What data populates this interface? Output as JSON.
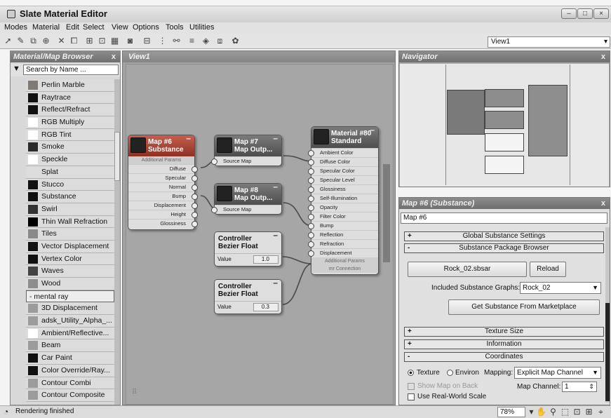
{
  "window": {
    "title": "Slate Material Editor",
    "min": "–",
    "max": "□",
    "close": "×"
  },
  "menu": [
    "Modes",
    "Material",
    "Edit",
    "Select",
    "View",
    "Options",
    "Tools",
    "Utilities"
  ],
  "toolbar": {
    "view_select": "View1"
  },
  "browser": {
    "title": "Material/Map Browser",
    "close": "x",
    "search_placeholder": "Search by Name ...",
    "items": [
      {
        "label": "Perlin Marble",
        "swatch": "#7f7a74"
      },
      {
        "label": "Raytrace",
        "swatch": "#111111"
      },
      {
        "label": "Reflect/Refract",
        "swatch": "#111111"
      },
      {
        "label": "RGB Multiply",
        "swatch": "#ffffff"
      },
      {
        "label": "RGB Tint",
        "swatch": "#ffffff"
      },
      {
        "label": "Smoke",
        "swatch": "#2b2b2b"
      },
      {
        "label": "Speckle",
        "swatch": "#ffffff"
      },
      {
        "label": "Splat",
        "swatch": "#dddddd"
      },
      {
        "label": "Stucco",
        "swatch": "#111111"
      },
      {
        "label": "Substance",
        "swatch": "#111111"
      },
      {
        "label": "Swirl",
        "swatch": "#333333"
      },
      {
        "label": "Thin Wall Refraction",
        "swatch": "#000000"
      },
      {
        "label": "Tiles",
        "swatch": "#8a8a8a"
      },
      {
        "label": "Vector Displacement",
        "swatch": "#111111"
      },
      {
        "label": "Vertex Color",
        "swatch": "#111111"
      },
      {
        "label": "Waves",
        "swatch": "#444444"
      },
      {
        "label": "Wood",
        "swatch": "#8d8d8d"
      }
    ],
    "category": "- mental ray",
    "mr_items": [
      {
        "label": "3D Displacement",
        "swatch": "#9c9c9c"
      },
      {
        "label": "adsk_Utility_Alpha_...",
        "swatch": "#9c9c9c"
      },
      {
        "label": "Ambient/Reflective...",
        "swatch": "#ffffff"
      },
      {
        "label": "Beam",
        "swatch": "#9c9c9c"
      },
      {
        "label": "Car Paint",
        "swatch": "#111111"
      },
      {
        "label": "Color Override/Ray...",
        "swatch": "#111111"
      },
      {
        "label": "Contour Combi",
        "swatch": "#9c9c9c"
      },
      {
        "label": "Contour Composite",
        "swatch": "#9c9c9c"
      }
    ]
  },
  "view": {
    "tab": "View1"
  },
  "nodes": {
    "substance": {
      "line1": "Map #6",
      "line2": "Substance",
      "sub": "Additional Params",
      "slots": [
        "Diffuse",
        "Specular",
        "Normal",
        "Bump",
        "Displacement",
        "Height",
        "Glossiness"
      ]
    },
    "map7": {
      "line1": "Map #7",
      "line2": "Map Outp...",
      "slot": "Source Map"
    },
    "map8": {
      "line1": "Map #8",
      "line2": "Map Outp...",
      "slot": "Source Map"
    },
    "material": {
      "line1": "Material #80",
      "line2": "Standard",
      "slots": [
        "Ambient Color",
        "Diffuse Color",
        "Specular Color",
        "Specular Level",
        "Glossiness",
        "Self-Illumination",
        "Opacity",
        "Filter Color",
        "Bump",
        "Reflection",
        "Refraction",
        "Displacement"
      ],
      "sub1": "Additional Params",
      "sub2": "mr Connection"
    },
    "ctrl1": {
      "line1": "Controller",
      "line2": "Bezier Float",
      "label": "Value",
      "value": "1.0"
    },
    "ctrl2": {
      "line1": "Controller",
      "line2": "Bezier Float",
      "label": "Value",
      "value": "0.3"
    }
  },
  "navigator": {
    "title": "Navigator",
    "close": "x"
  },
  "params": {
    "title": "Map #6 (Substance)",
    "close": "x",
    "name": "Map #6",
    "rollouts": {
      "global": {
        "sign": "+",
        "label": "Global Substance Settings"
      },
      "package": {
        "sign": "-",
        "label": "Substance Package Browser"
      },
      "texture": {
        "sign": "+",
        "label": "Texture Size"
      },
      "info": {
        "sign": "+",
        "label": "Information"
      },
      "coords": {
        "sign": "-",
        "label": "Coordinates"
      }
    },
    "sbsar": "Rock_02.sbsar",
    "reload": "Reload",
    "graphs_label": "Included Substance Graphs:",
    "graphs_value": "Rock_02",
    "marketplace": "Get Substance From Marketplace",
    "texture_label": "Texture",
    "environ_label": "Environ",
    "mapping_label": "Mapping:",
    "mapping_value": "Explicit Map Channel",
    "show_map": "Show Map on Back",
    "channel_label": "Map Channel:",
    "channel_value": "1",
    "real_world": "Use Real-World Scale"
  },
  "status": {
    "text": "Rendering finished",
    "zoom": "78%"
  }
}
